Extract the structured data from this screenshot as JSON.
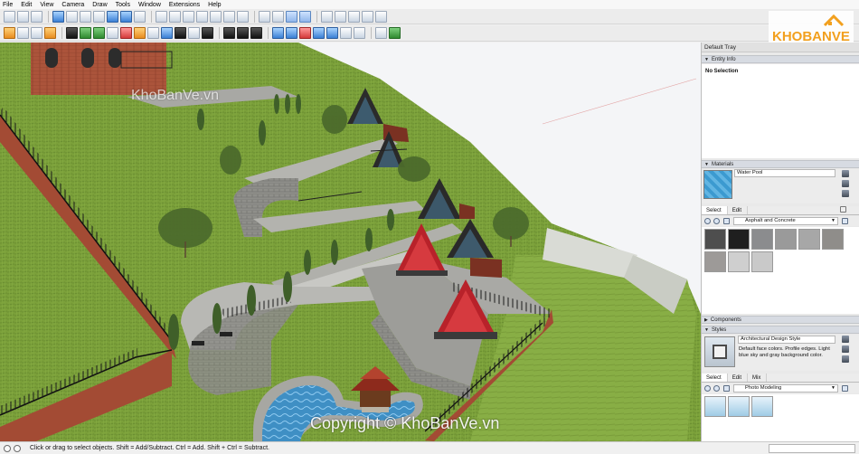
{
  "menu": [
    "File",
    "Edit",
    "View",
    "Camera",
    "Draw",
    "Tools",
    "Window",
    "Extensions",
    "Help"
  ],
  "watermarks": {
    "small": "KhoBanVe.vn",
    "copyright": "Copyright © KhoBanVe.vn",
    "logo": "KHOBANVE"
  },
  "tray": {
    "title": "Default Tray",
    "entity_info": {
      "header": "Entity Info",
      "selection": "No Selection"
    },
    "materials": {
      "header": "Materials",
      "current_name": "Water Pool",
      "tabs": [
        "Select",
        "Edit"
      ],
      "library": "Asphalt and Concrete",
      "swatch_colors": [
        "#4e4e4e",
        "#1f1f1f",
        "#8b8c8e",
        "#9a9a9a",
        "#a7a7a7",
        "#8f8d8a",
        "#9d9a98",
        "#cfcfcf",
        "#c9c9c9"
      ]
    },
    "components": {
      "header": "Components"
    },
    "styles": {
      "header": "Styles",
      "style_name": "Architectural Design Style",
      "description": "Default face colors. Profile edges. Light blue sky and gray background color.",
      "tabs": [
        "Select",
        "Edit",
        "Mix"
      ],
      "library": "Photo Modeling"
    }
  },
  "status": {
    "message": "Click or drag to select objects. Shift = Add/Subtract. Ctrl = Add. Shift + Ctrl = Subtract."
  }
}
